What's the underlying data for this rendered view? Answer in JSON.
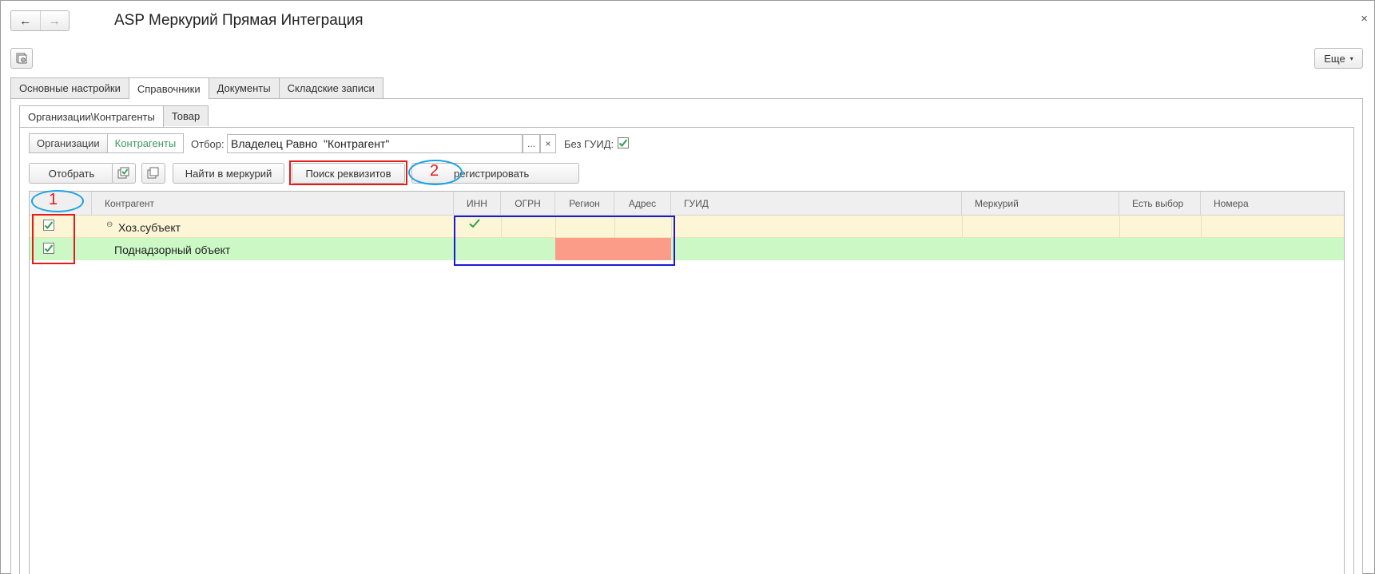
{
  "window": {
    "title": "ASP Меркурий Прямая Интеграция",
    "back_icon": "←",
    "forward_icon": "→",
    "close_icon": "×"
  },
  "toolbar": {
    "more_label": "Еще",
    "more_caret": "▾"
  },
  "main_tabs": [
    {
      "label": "Основные настройки"
    },
    {
      "label": "Справочники"
    },
    {
      "label": "Документы"
    },
    {
      "label": "Складские записи"
    }
  ],
  "sub_tabs": [
    {
      "label": "Организации\\Контрагенты"
    },
    {
      "label": "Товар"
    }
  ],
  "filter": {
    "segments": [
      {
        "label": "Организации"
      },
      {
        "label": "Контрагенты"
      }
    ],
    "label": "Отбор:",
    "value": "Владелец Равно  \"Контрагент\"",
    "dots": "...",
    "clear": "×",
    "no_guid_label": "Без ГУИД:",
    "no_guid_checked": true
  },
  "actions": {
    "select": "Отобрать",
    "find_mercury": "Найти в меркурий",
    "search_details": "Поиск реквизитов",
    "register": "регистрировать"
  },
  "table": {
    "columns": [
      {
        "label": "Контрагент"
      },
      {
        "label": "ИНН"
      },
      {
        "label": "ОГРН"
      },
      {
        "label": "Регион"
      },
      {
        "label": "Адрес"
      },
      {
        "label": "ГУИД"
      },
      {
        "label": "Меркурий"
      },
      {
        "label": "Есть выбор"
      },
      {
        "label": "Номера"
      }
    ],
    "rows": [
      {
        "name": "Хоз.субъект",
        "checked": true,
        "inn_ok": true,
        "expand": "⊖"
      },
      {
        "name": "Поднадзорный объект",
        "checked": true,
        "inn_ok": false
      }
    ]
  },
  "annotations": {
    "num1": "1",
    "num2": "2"
  },
  "colors": {
    "accent_green": "#3c9a5f",
    "row1_bg": "#fcf5d6",
    "row2_bg": "#ccf8c6",
    "error_cell": "#fa9c87",
    "anno_red": "#e21b1b",
    "anno_blue": "#1a1ad6",
    "anno_cyan": "#1aa0e6"
  }
}
